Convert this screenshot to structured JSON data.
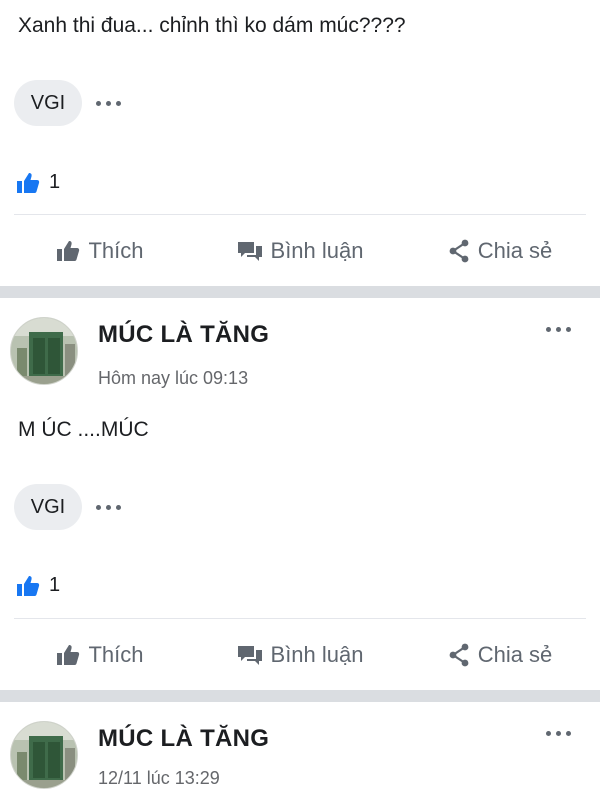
{
  "top_post": {
    "text": "Xanh thi đua... chỉnh thì ko dám múc????",
    "reply_chip": "VGI",
    "more_icon": "more-horizontal-icon",
    "like_count": "1"
  },
  "actions": {
    "like": "Thích",
    "comment": "Bình luận",
    "share": "Chia sẻ"
  },
  "post2": {
    "author": "MÚC LÀ TĂNG",
    "time": "Hôm nay lúc 09:13",
    "text": "M  ÚC ....MÚC",
    "reply_chip": "VGI",
    "like_count": "1"
  },
  "post3": {
    "author": "MÚC LÀ TĂNG",
    "time": "12/11 lúc 13:29"
  },
  "colors": {
    "like_blue": "#1877f2",
    "secondary_text": "#606770",
    "separator": "#dadde1"
  }
}
